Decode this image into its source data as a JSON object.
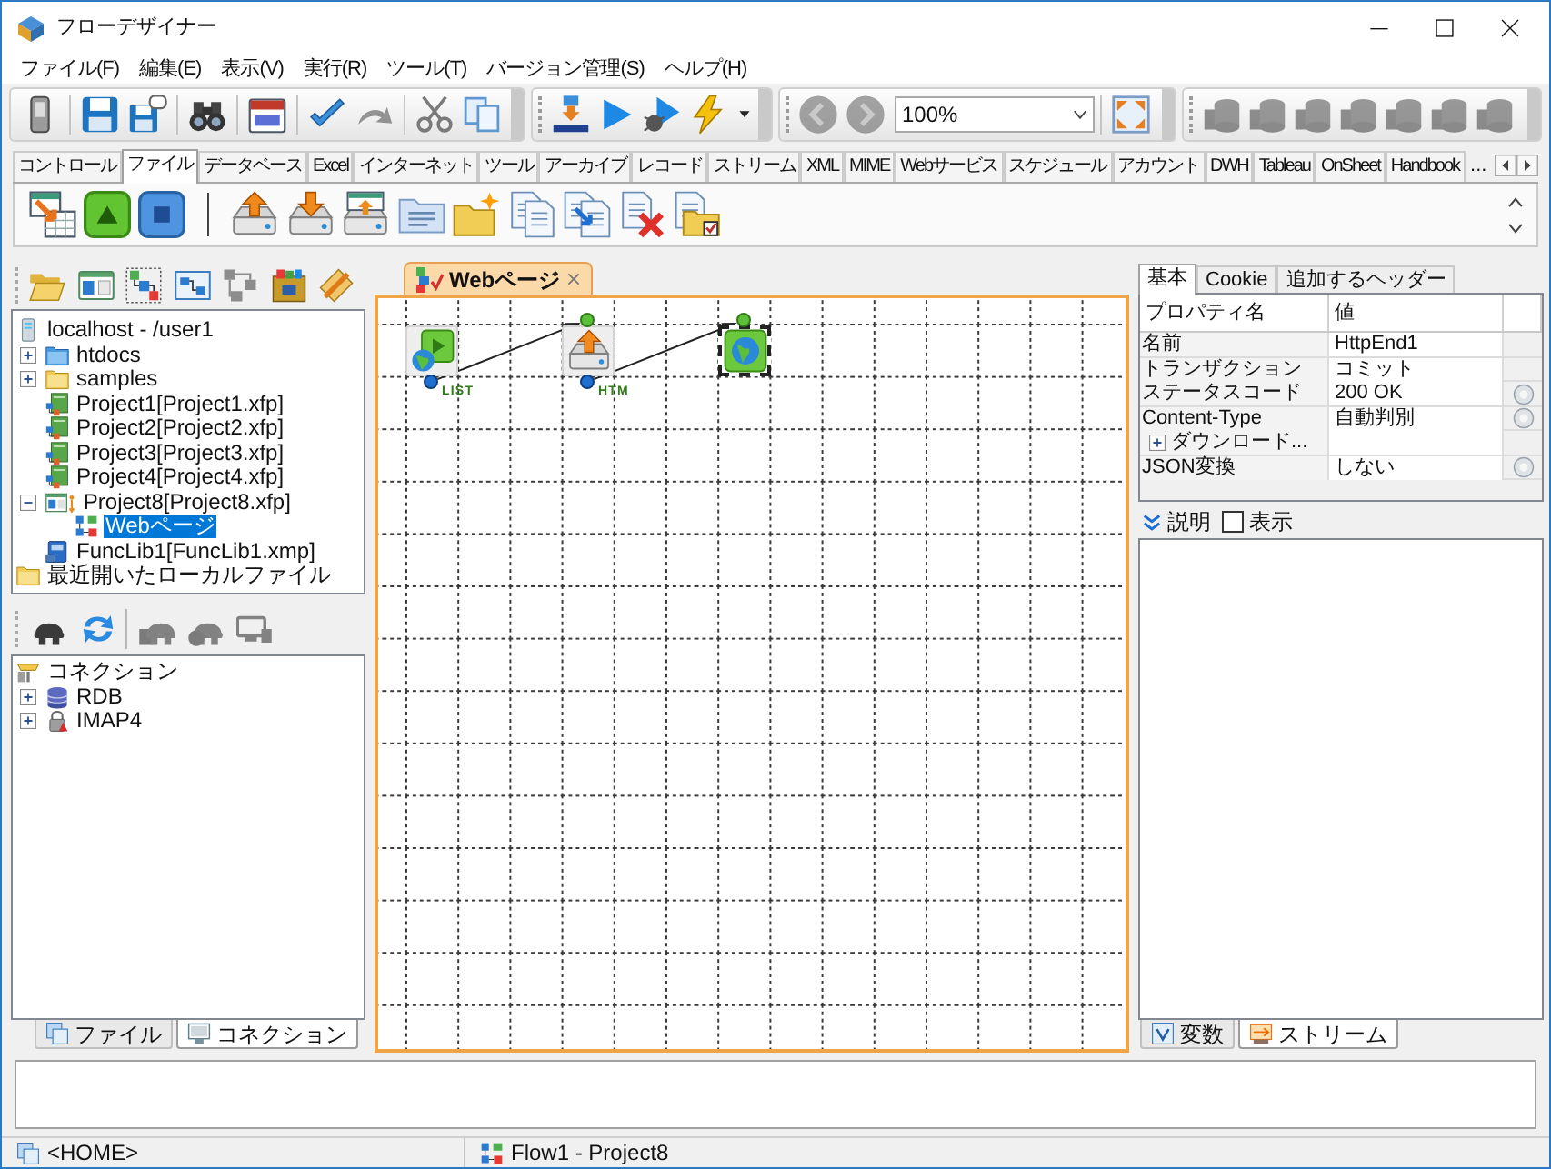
{
  "window": {
    "title": "フローデザイナー"
  },
  "menu": [
    "ファイル(F)",
    "編集(E)",
    "表示(V)",
    "実行(R)",
    "ツール(T)",
    "バージョン管理(S)",
    "ヘルプ(H)"
  ],
  "toolbar": [
    [
      [
        {
          "kind": "device",
          "disabled": false
        }
      ],
      [
        {
          "kind": "save",
          "disabled": false
        },
        {
          "kind": "save_as",
          "disabled": false
        }
      ],
      [
        {
          "kind": "find",
          "disabled": false
        }
      ],
      [
        {
          "kind": "calendar",
          "disabled": false
        }
      ],
      [
        {
          "kind": "undo",
          "disabled": false
        },
        {
          "kind": "redo",
          "disabled": true
        }
      ],
      [
        {
          "kind": "cut",
          "disabled": false
        },
        {
          "kind": "copy",
          "disabled": false
        }
      ]
    ],
    [
      [
        {
          "kind": "binary",
          "disabled": false
        },
        {
          "kind": "run",
          "disabled": false
        },
        {
          "kind": "debug",
          "disabled": false
        },
        {
          "kind": "lightning",
          "disabled": false
        },
        {
          "kind": "dropdown",
          "disabled": false
        }
      ]
    ],
    [
      [
        {
          "kind": "back",
          "disabled": true
        },
        {
          "kind": "forward",
          "disabled": true
        },
        {
          "kind": "zoom",
          "value": "100%",
          "disabled": false
        }
      ],
      [
        {
          "kind": "fit",
          "disabled": false
        }
      ]
    ],
    [
      [
        {
          "kind": "db",
          "disabled": true
        },
        {
          "kind": "db",
          "disabled": true
        },
        {
          "kind": "db",
          "disabled": true
        },
        {
          "kind": "db",
          "disabled": true
        },
        {
          "kind": "db",
          "disabled": true
        },
        {
          "kind": "db",
          "disabled": true
        },
        {
          "kind": "db",
          "disabled": true
        }
      ]
    ]
  ],
  "palette": {
    "tabs": [
      {
        "label": "コントロール",
        "selected": false
      },
      {
        "label": "ファイル",
        "selected": true
      },
      {
        "label": "データベース",
        "selected": false
      },
      {
        "label": "Excel",
        "selected": false
      },
      {
        "label": "インターネット",
        "selected": false
      },
      {
        "label": "ツール",
        "selected": false
      },
      {
        "label": "アーカイブ",
        "selected": false
      },
      {
        "label": "レコード",
        "selected": false
      },
      {
        "label": "ストリーム",
        "selected": false
      },
      {
        "label": "XML",
        "selected": false
      },
      {
        "label": "MIME",
        "selected": false
      },
      {
        "label": "Webサービス",
        "selected": false
      },
      {
        "label": "スケジュール",
        "selected": false
      },
      {
        "label": "アカウント",
        "selected": false
      },
      {
        "label": "DWH",
        "selected": false
      },
      {
        "label": "Tableau",
        "selected": false
      },
      {
        "label": "OnSheet",
        "selected": false
      },
      {
        "label": "Handbook",
        "selected": false
      }
    ],
    "more": "..."
  },
  "file_panel": {
    "toolbar": [
      {
        "kind": "open_folder",
        "disabled": false
      },
      {
        "kind": "panes",
        "disabled": false
      },
      {
        "kind": "flow_select",
        "disabled": false
      },
      {
        "kind": "flow_panes",
        "disabled": false
      },
      {
        "kind": "hierarchy",
        "disabled": true
      },
      {
        "kind": "chest",
        "disabled": false
      },
      {
        "kind": "pencil",
        "disabled": false
      }
    ],
    "tree": [
      {
        "kind": "server",
        "label": "localhost - /user1",
        "selected": false,
        "children": [
          {
            "kind": "folder_blue",
            "label": "htdocs",
            "expanded": false,
            "selected": false
          },
          {
            "kind": "folder",
            "label": "samples",
            "expanded": false,
            "selected": false
          },
          {
            "kind": "project",
            "label": "Project1[Project1.xfp]",
            "selected": false
          },
          {
            "kind": "project",
            "label": "Project2[Project2.xfp]",
            "selected": false
          },
          {
            "kind": "project",
            "label": "Project3[Project3.xfp]",
            "selected": false
          },
          {
            "kind": "project",
            "label": "Project4[Project4.xfp]",
            "selected": false
          },
          {
            "kind": "project_open",
            "label": "Project8[Project8.xfp]",
            "expanded": true,
            "selected": false,
            "children": [
              {
                "kind": "flow",
                "label": "Webページ",
                "selected": true
              }
            ]
          },
          {
            "kind": "library",
            "label": "FuncLib1[FuncLib1.xmp]",
            "selected": false
          }
        ]
      },
      {
        "kind": "folder",
        "label": "最近開いたローカルファイル",
        "selected": false
      }
    ]
  },
  "connection_panel": {
    "toolbar": [
      {
        "kind": "helmet",
        "disabled": false
      },
      {
        "kind": "refresh",
        "disabled": false
      },
      {
        "kind": "helmet_box",
        "disabled": true
      },
      {
        "kind": "helmet_x",
        "disabled": true
      },
      {
        "kind": "helmet_screen",
        "disabled": true
      }
    ],
    "tree": [
      {
        "kind": "tray",
        "label": "コネクション",
        "selected": false,
        "children": [
          {
            "kind": "database",
            "label": "RDB",
            "expanded": false,
            "selected": false
          },
          {
            "kind": "mail",
            "label": "IMAP4",
            "expanded": false,
            "selected": false
          }
        ]
      }
    ]
  },
  "left_tabs": [
    {
      "label": "ファイル",
      "selected": false
    },
    {
      "label": "コネクション",
      "selected": true
    }
  ],
  "editor": {
    "tabs": [
      {
        "label": "Webページ",
        "selected": true
      }
    ],
    "nodes": [
      {
        "kind": "start",
        "label": "LIST",
        "selected": false,
        "output": true
      },
      {
        "kind": "upload",
        "label": "HTM",
        "selected": false,
        "output": true
      },
      {
        "kind": "end",
        "selected": true,
        "output": false
      }
    ]
  },
  "properties": {
    "tabs": [
      {
        "label": "基本",
        "selected": true
      },
      {
        "label": "Cookie",
        "selected": false
      },
      {
        "label": "追加するヘッダー",
        "selected": false
      }
    ],
    "columns": [
      "プロパティ名",
      "値"
    ],
    "rows": [
      {
        "kind": "text",
        "name": "名前",
        "value": "HttpEnd1"
      },
      {
        "kind": "text",
        "name": "トランザクション",
        "value": "コミット"
      },
      {
        "kind": "choice",
        "name": "ステータスコード",
        "value": "200 OK"
      },
      {
        "kind": "choice",
        "name": "Content-Type",
        "value": "自動判別"
      },
      {
        "kind": "group",
        "name": "ダウンロード...",
        "expanded": false
      },
      {
        "kind": "choice",
        "name": "JSON変換",
        "value": "しない"
      }
    ],
    "description": {
      "title": "説明",
      "toggle": {
        "label": "表示",
        "checked": false
      }
    },
    "bottom_tabs": [
      {
        "label": "変数",
        "selected": false
      },
      {
        "label": "ストリーム",
        "selected": true
      }
    ]
  },
  "status_bar": [
    "<HOME>",
    "Flow1 - Project8"
  ]
}
